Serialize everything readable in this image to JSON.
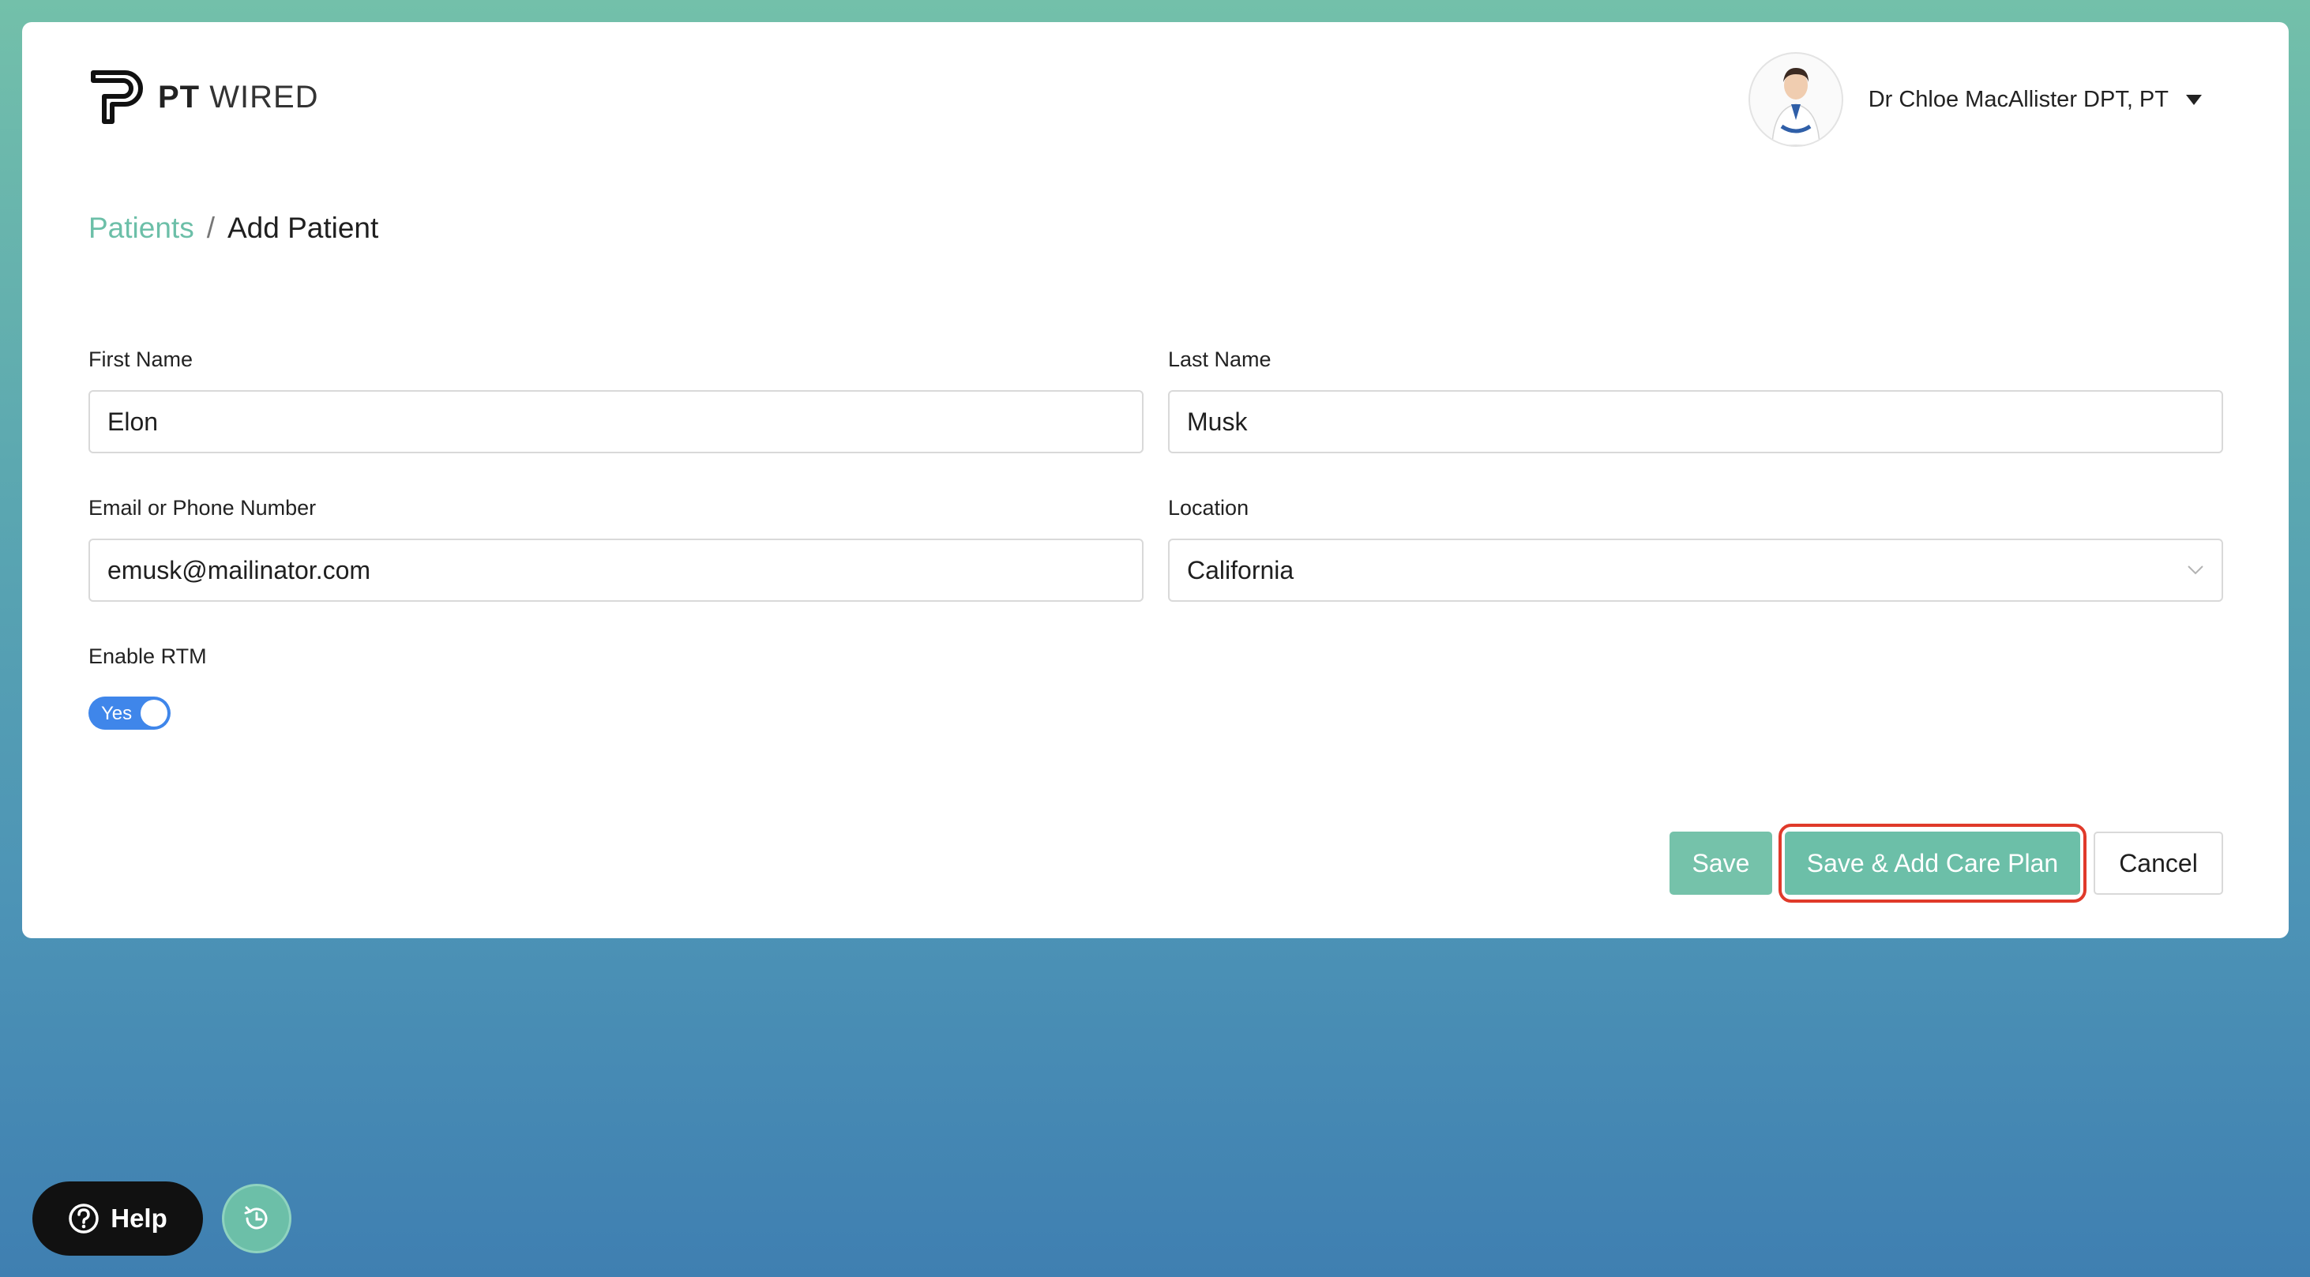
{
  "brand": {
    "name_bold": "PT",
    "name_regular": "WIRED"
  },
  "user": {
    "name": "Dr Chloe MacAllister DPT, PT"
  },
  "breadcrumb": {
    "parent": "Patients",
    "separator": "/",
    "current": "Add Patient"
  },
  "form": {
    "first_name": {
      "label": "First Name",
      "value": "Elon"
    },
    "last_name": {
      "label": "Last Name",
      "value": "Musk"
    },
    "contact": {
      "label": "Email or Phone Number",
      "value": "emusk@mailinator.com"
    },
    "location": {
      "label": "Location",
      "value": "California"
    },
    "rtm": {
      "label": "Enable RTM",
      "toggle_text": "Yes",
      "enabled": true
    }
  },
  "actions": {
    "save_label": "Save",
    "save_care_plan_label": "Save & Add Care Plan",
    "cancel_label": "Cancel"
  },
  "help": {
    "label": "Help"
  },
  "colors": {
    "accent": "#6cbfa8",
    "toggle_on": "#3f86ea",
    "highlight": "#e03a2a"
  },
  "icons": {
    "logo": "pt-logo-icon",
    "dropdown": "caret-down-icon",
    "select": "chevron-down-icon",
    "help": "question-circle-icon",
    "clock": "clock-history-icon"
  }
}
